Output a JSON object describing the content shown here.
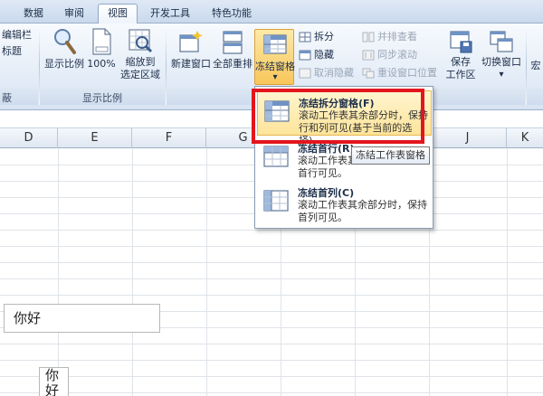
{
  "tabs": [
    {
      "label": "数据",
      "active": false
    },
    {
      "label": "审阅",
      "active": false
    },
    {
      "label": "视图",
      "active": true
    },
    {
      "label": "开发工具",
      "active": false
    },
    {
      "label": "特色功能",
      "active": false
    }
  ],
  "ribbon": {
    "partial_left": {
      "edit_bar": "编辑栏",
      "headings": "标题",
      "cut_label": "蔽"
    },
    "zoom_group": {
      "label": "显示比例",
      "zoom": "显示比例",
      "zoom_100": "100%",
      "zoom_selection_line1": "缩放到",
      "zoom_selection_line2": "选定区域"
    },
    "window_group": {
      "new_window": "新建窗口",
      "arrange_all": "全部重排",
      "freeze_panes": "冻结窗格",
      "split": "拆分",
      "hide": "隐藏",
      "unhide": "取消隐藏",
      "side_by_side": "并排查看",
      "sync_scroll": "同步滚动",
      "reset_position": "重设窗口位置",
      "save_workspace_line1": "保存",
      "save_workspace_line2": "工作区",
      "switch_window": "切换窗口",
      "dropdown_arrow": "▾",
      "partial_right": "宏"
    }
  },
  "columns": [
    "D",
    "E",
    "F",
    "G",
    "H",
    "I",
    "J",
    "K"
  ],
  "cells": {
    "box1": "你好",
    "box2_line1": "你",
    "box2_line2": "好"
  },
  "freeze_menu": {
    "items": [
      {
        "title": "冻结拆分窗格(F)",
        "desc_line1": "滚动工作表其余部分时，保持",
        "desc_line2": "行和列可见(基于当前的选择)。",
        "highlighted": true
      },
      {
        "title": "冻结首行(R)",
        "desc_line1": "滚动工作表其",
        "desc_line2": "首行可见。",
        "highlighted": false
      },
      {
        "title": "冻结首列(C)",
        "desc_line1": "滚动工作表其余部分时，保持",
        "desc_line2": "首列可见。",
        "highlighted": false
      }
    ]
  },
  "tooltip": "冻结工作表窗格",
  "colors": {
    "highlight_border": "#e3151d",
    "menu_highlight": "#fde49a",
    "ribbon_bg": "#e6eef8"
  }
}
